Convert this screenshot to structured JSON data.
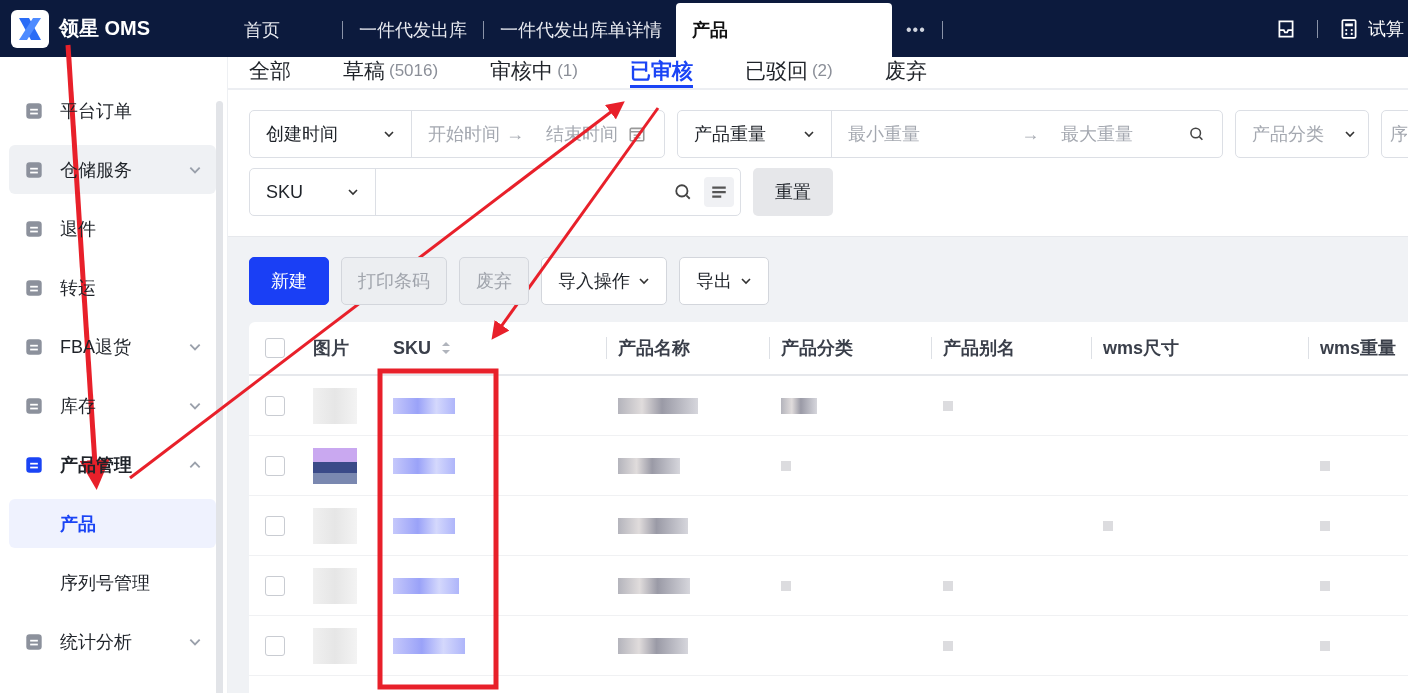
{
  "app": {
    "name": "领星 OMS"
  },
  "top_tabs": [
    {
      "label": "首页",
      "selected": false
    },
    {
      "label": "一件代发出库",
      "selected": false
    },
    {
      "label": "一件代发出库单详情",
      "selected": false
    },
    {
      "label": "产品",
      "selected": true
    }
  ],
  "more": "•••",
  "top_right": {
    "calc_label": "试算"
  },
  "sidebar": {
    "items": [
      {
        "label": "平台订单"
      },
      {
        "label": "仓储服务",
        "expanded": false,
        "highlighted": true
      },
      {
        "label": "退件"
      },
      {
        "label": "转运"
      },
      {
        "label": "FBA退货",
        "expanded": false
      },
      {
        "label": "库存",
        "expanded": false
      },
      {
        "label": "产品管理",
        "expanded": true,
        "children": [
          {
            "label": "产品",
            "selected": true
          },
          {
            "label": "序列号管理",
            "selected": false
          }
        ]
      },
      {
        "label": "统计分析",
        "expanded": false
      }
    ]
  },
  "status_tabs": [
    {
      "label": "全部",
      "selected": false
    },
    {
      "label": "草稿",
      "count": "(5016)",
      "selected": false
    },
    {
      "label": "审核中",
      "count": "(1)",
      "selected": false
    },
    {
      "label": "已审核",
      "selected": true
    },
    {
      "label": "已驳回",
      "count": "(2)",
      "selected": false
    },
    {
      "label": "废弃",
      "selected": false
    }
  ],
  "filters": {
    "date": {
      "select": "创建时间",
      "start_placeholder": "开始时间",
      "end_placeholder": "结束时间",
      "separator": "→"
    },
    "weight": {
      "select": "产品重量",
      "min_placeholder": "最小重量",
      "max_placeholder": "最大重量",
      "separator": "→"
    },
    "category": {
      "placeholder": "产品分类"
    },
    "cut_field": {
      "placeholder": "序"
    },
    "sku": {
      "select": "SKU"
    },
    "reset": "重置"
  },
  "toolbar": [
    {
      "label": "新建",
      "kind": "primary",
      "disabled": false
    },
    {
      "label": "打印条码",
      "kind": "plain",
      "disabled": true
    },
    {
      "label": "废弃",
      "kind": "plain",
      "disabled": true
    },
    {
      "label": "导入操作",
      "kind": "dropdown",
      "disabled": false
    },
    {
      "label": "导出",
      "kind": "dropdown",
      "disabled": false
    }
  ],
  "table": {
    "columns": [
      "图片",
      "SKU",
      "产品名称",
      "产品分类",
      "产品别名",
      "wms尺寸",
      "wms重量"
    ],
    "select_all": {
      "checked": false
    },
    "rows": [
      {
        "checked": false
      },
      {
        "checked": false
      },
      {
        "checked": false
      },
      {
        "checked": false
      },
      {
        "checked": false
      }
    ]
  }
}
